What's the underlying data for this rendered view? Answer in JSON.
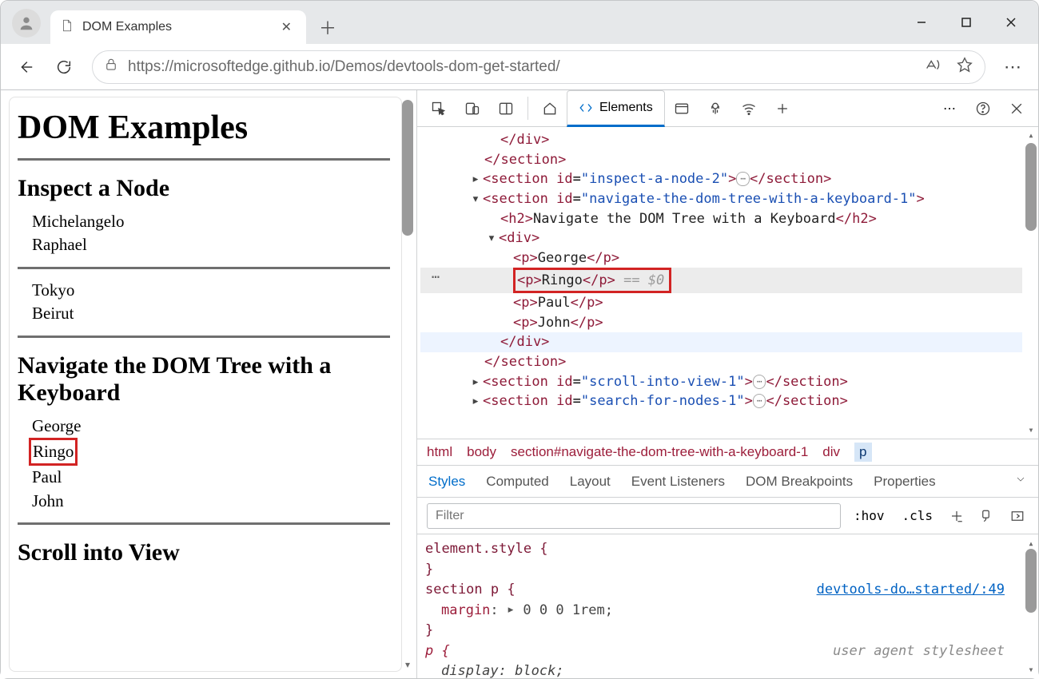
{
  "browser": {
    "tab_title": "DOM Examples",
    "url": "https://microsoftedge.github.io/Demos/devtools-dom-get-started/"
  },
  "page": {
    "h1": "DOM Examples",
    "h2_inspect": "Inspect a Node",
    "inspect_group1": [
      "Michelangelo",
      "Raphael"
    ],
    "inspect_group2": [
      "Tokyo",
      "Beirut"
    ],
    "h2_navigate": "Navigate the DOM Tree with a Keyboard",
    "navigate_list": [
      "George",
      "Ringo",
      "Paul",
      "John"
    ],
    "h2_scroll": "Scroll into View"
  },
  "devtools": {
    "elements_tab": "Elements",
    "dom_lines": {
      "close_div": "</div>",
      "close_section": "</section>",
      "sec_inspect2_id": "inspect-a-node-2",
      "sec_nav_id": "navigate-the-dom-tree-with-a-keyboard-1",
      "h2_text": "Navigate the DOM Tree with a Keyboard",
      "names": [
        "George",
        "Ringo",
        "Paul",
        "John"
      ],
      "eq0": "== $0",
      "sec_scroll_id": "scroll-into-view-1",
      "sec_search_id": "search-for-nodes-1"
    },
    "crumbs": [
      "html",
      "body",
      "section#navigate-the-dom-tree-with-a-keyboard-1",
      "div",
      "p"
    ],
    "subtabs": [
      "Styles",
      "Computed",
      "Layout",
      "Event Listeners",
      "DOM Breakpoints",
      "Properties"
    ],
    "filter_placeholder": "Filter",
    "hov": ":hov",
    "cls": ".cls",
    "rules": {
      "element_style": "element.style {",
      "close": "}",
      "section_p": "section p {",
      "margin_label": "margin",
      "margin_value": "0 0 0 1rem;",
      "src": "devtools-do…started/:49",
      "p_sel": "p {",
      "display_label": "display",
      "display_value": "block;",
      "ua": "user agent stylesheet"
    }
  }
}
